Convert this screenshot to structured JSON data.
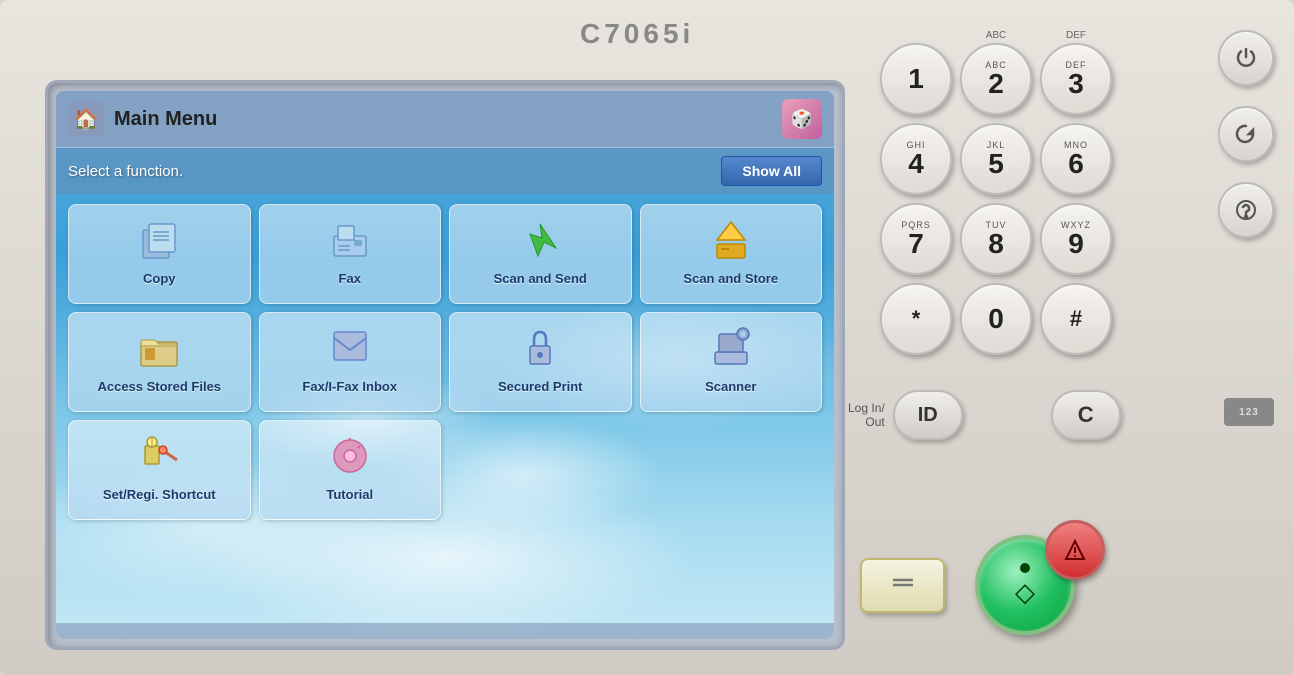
{
  "machine": {
    "model": "C7065i"
  },
  "screen": {
    "title": "Main Menu",
    "subtitle": "Select a function.",
    "show_all_label": "Show All",
    "icon_3d": "🎲"
  },
  "functions": [
    {
      "id": "copy",
      "label": "Copy",
      "icon": "📄",
      "row": 1,
      "col": 1
    },
    {
      "id": "fax",
      "label": "Fax",
      "icon": "📠",
      "row": 1,
      "col": 2
    },
    {
      "id": "scan-send",
      "label": "Scan and Send",
      "icon": "✈️",
      "row": 1,
      "col": 3
    },
    {
      "id": "scan-store",
      "label": "Scan and Store",
      "icon": "📦",
      "row": 1,
      "col": 4
    },
    {
      "id": "access-stored",
      "label": "Access Stored Files",
      "icon": "🗂️",
      "row": 2,
      "col": 1
    },
    {
      "id": "fax-inbox",
      "label": "Fax/I-Fax Inbox",
      "icon": "📋",
      "row": 2,
      "col": 2
    },
    {
      "id": "secured-print",
      "label": "Secured Print",
      "icon": "🔒",
      "row": 2,
      "col": 3
    },
    {
      "id": "scanner",
      "label": "Scanner",
      "icon": "🖥️",
      "row": 2,
      "col": 4
    },
    {
      "id": "setregi",
      "label": "Set/Regi. Shortcut",
      "icon": "⚙️",
      "row": 3,
      "col": 1
    },
    {
      "id": "tutorial",
      "label": "Tutorial",
      "icon": "🎯",
      "row": 3,
      "col": 2
    }
  ],
  "keypad": {
    "keys": [
      {
        "number": "1",
        "letters": ""
      },
      {
        "number": "2",
        "letters": "ABC"
      },
      {
        "number": "3",
        "letters": "DEF"
      },
      {
        "number": "4",
        "letters": "GHI"
      },
      {
        "number": "5",
        "letters": "JKL"
      },
      {
        "number": "6",
        "letters": "MNO"
      },
      {
        "number": "7",
        "letters": "PQRS"
      },
      {
        "number": "8",
        "letters": "TUV"
      },
      {
        "number": "9",
        "letters": "WXYZ"
      },
      {
        "number": "*",
        "letters": ""
      },
      {
        "number": "0",
        "letters": ""
      },
      {
        "number": "#",
        "letters": ""
      }
    ]
  },
  "controls": {
    "power_icon": "⏻",
    "reset_icon": "↺",
    "interrupt_icon": "✕",
    "login_label": "Log In/\nOut",
    "id_label": "ID",
    "c_label": "C",
    "num_indicator": "123",
    "clear_label": "//",
    "start_label": "◇",
    "stop_label": "⊗"
  }
}
